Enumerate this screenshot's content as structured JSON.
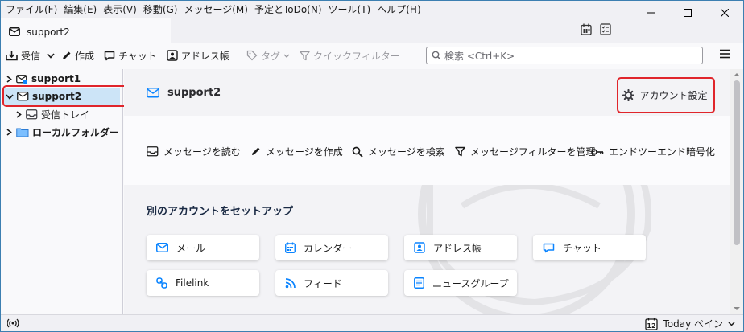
{
  "menubar": {
    "items": [
      "ファイル(F)",
      "編集(E)",
      "表示(V)",
      "移動(G)",
      "メッセージ(M)",
      "予定とToDo(N)",
      "ツール(T)",
      "ヘルプ(H)"
    ]
  },
  "tab": {
    "title": "support2",
    "icon": "envelope-icon"
  },
  "toolbar": {
    "get_messages": "受信",
    "write": "作成",
    "chat": "チャット",
    "address_book": "アドレス帳",
    "tag": "タグ",
    "quick_filter": "クイックフィルター",
    "search_placeholder": "検索 <Ctrl+K>"
  },
  "folders": [
    {
      "label": "support1",
      "icon": "envelope-icon",
      "expanded": false
    },
    {
      "label": "support2",
      "icon": "envelope-icon",
      "expanded": true,
      "selected": true
    },
    {
      "label": "受信トレイ",
      "icon": "inbox-icon"
    },
    {
      "label": "ローカルフォルダー",
      "icon": "folder-icon",
      "expanded": false
    }
  ],
  "account": {
    "name": "support2",
    "settings": "アカウント設定"
  },
  "actions": [
    {
      "label": "メッセージを読む",
      "icon": "inbox-icon"
    },
    {
      "label": "メッセージを作成",
      "icon": "pencil-icon"
    },
    {
      "label": "メッセージを検索",
      "icon": "search-icon"
    },
    {
      "label": "メッセージフィルターを管理",
      "icon": "filter-icon"
    },
    {
      "label": "エンドツーエンド暗号化",
      "icon": "key-icon"
    }
  ],
  "setup": {
    "title": "別のアカウントをセットアップ",
    "cards": [
      {
        "label": "メール",
        "icon": "envelope-icon"
      },
      {
        "label": "カレンダー",
        "icon": "calendar-icon"
      },
      {
        "label": "アドレス帳",
        "icon": "address-book-icon"
      },
      {
        "label": "チャット",
        "icon": "chat-icon"
      },
      {
        "label": "Filelink",
        "icon": "link-icon"
      },
      {
        "label": "フィード",
        "icon": "rss-icon"
      },
      {
        "label": "ニュースグループ",
        "icon": "newsgroup-icon"
      }
    ]
  },
  "status": {
    "today_pane": "Today ペイン",
    "calendar_day": "12"
  },
  "colors": {
    "accent": "#0a84ff",
    "highlight": "#e0252b",
    "selected_bg": "#cce4f7"
  }
}
